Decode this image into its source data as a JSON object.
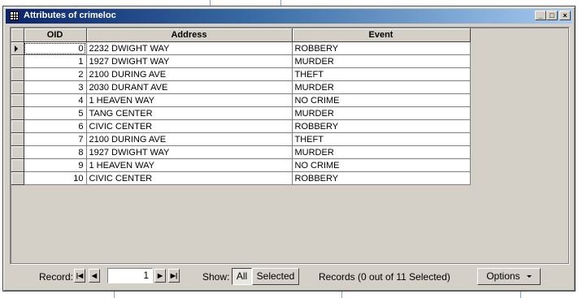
{
  "window": {
    "title": "Attributes of crimeloc"
  },
  "title_buttons": {
    "minimize": "_",
    "maximize": "□",
    "close": "×"
  },
  "table": {
    "columns": [
      "OID",
      "Address",
      "Event"
    ],
    "rows": [
      {
        "oid": "0",
        "address": "2232 DWIGHT WAY",
        "event": "ROBBERY"
      },
      {
        "oid": "1",
        "address": "1927 DWIGHT WAY",
        "event": "MURDER"
      },
      {
        "oid": "2",
        "address": "2100 DURING AVE",
        "event": "THEFT"
      },
      {
        "oid": "3",
        "address": "2030 DURANT AVE",
        "event": "MURDER"
      },
      {
        "oid": "4",
        "address": "1 HEAVEN WAY",
        "event": "NO CRIME"
      },
      {
        "oid": "5",
        "address": "TANG CENTER",
        "event": "MURDER"
      },
      {
        "oid": "6",
        "address": "CIVIC CENTER",
        "event": "ROBBERY"
      },
      {
        "oid": "7",
        "address": "2100 DURING AVE",
        "event": "THEFT"
      },
      {
        "oid": "8",
        "address": "1927 DWIGHT WAY",
        "event": "MURDER"
      },
      {
        "oid": "9",
        "address": "1 HEAVEN WAY",
        "event": "NO CRIME"
      },
      {
        "oid": "10",
        "address": "CIVIC CENTER",
        "event": "ROBBERY"
      }
    ]
  },
  "status": {
    "record_label": "Record:",
    "record_value": "1",
    "first_icon": "|◀",
    "prev_icon": "◀",
    "next_icon": "▶",
    "last_icon": "▶|",
    "show_label": "Show:",
    "all_label": "All",
    "selected_label": "Selected",
    "records_text": "Records (0 out of 11 Selected)",
    "options_label": "Options"
  }
}
